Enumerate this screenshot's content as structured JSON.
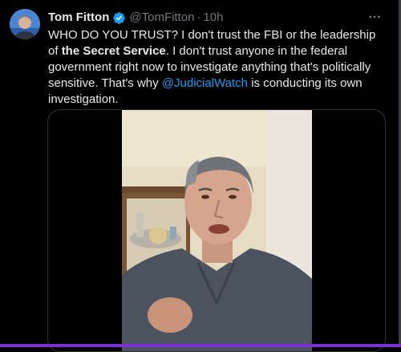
{
  "tweet": {
    "author_name": "Tom Fitton",
    "handle": "@TomFitton",
    "separator": "·",
    "time": "10h",
    "text_1": "WHO DO YOU TRUST? I don't trust the FBI or the leadership of ",
    "text_bold": "the Secret Service",
    "text_2": ". I don't trust anyone in the federal government right now to investigate anything that's politically sensitive. That's why ",
    "mention": "@JudicialWatch",
    "text_3": " is conducting its own investigation."
  },
  "icons": {
    "verified": "verified-badge-icon",
    "more": "more-options-icon"
  },
  "colors": {
    "background": "#000000",
    "text": "#e7e9ea",
    "muted": "#71767b",
    "link": "#1d9bf0",
    "verified": "#1d9bf0"
  }
}
